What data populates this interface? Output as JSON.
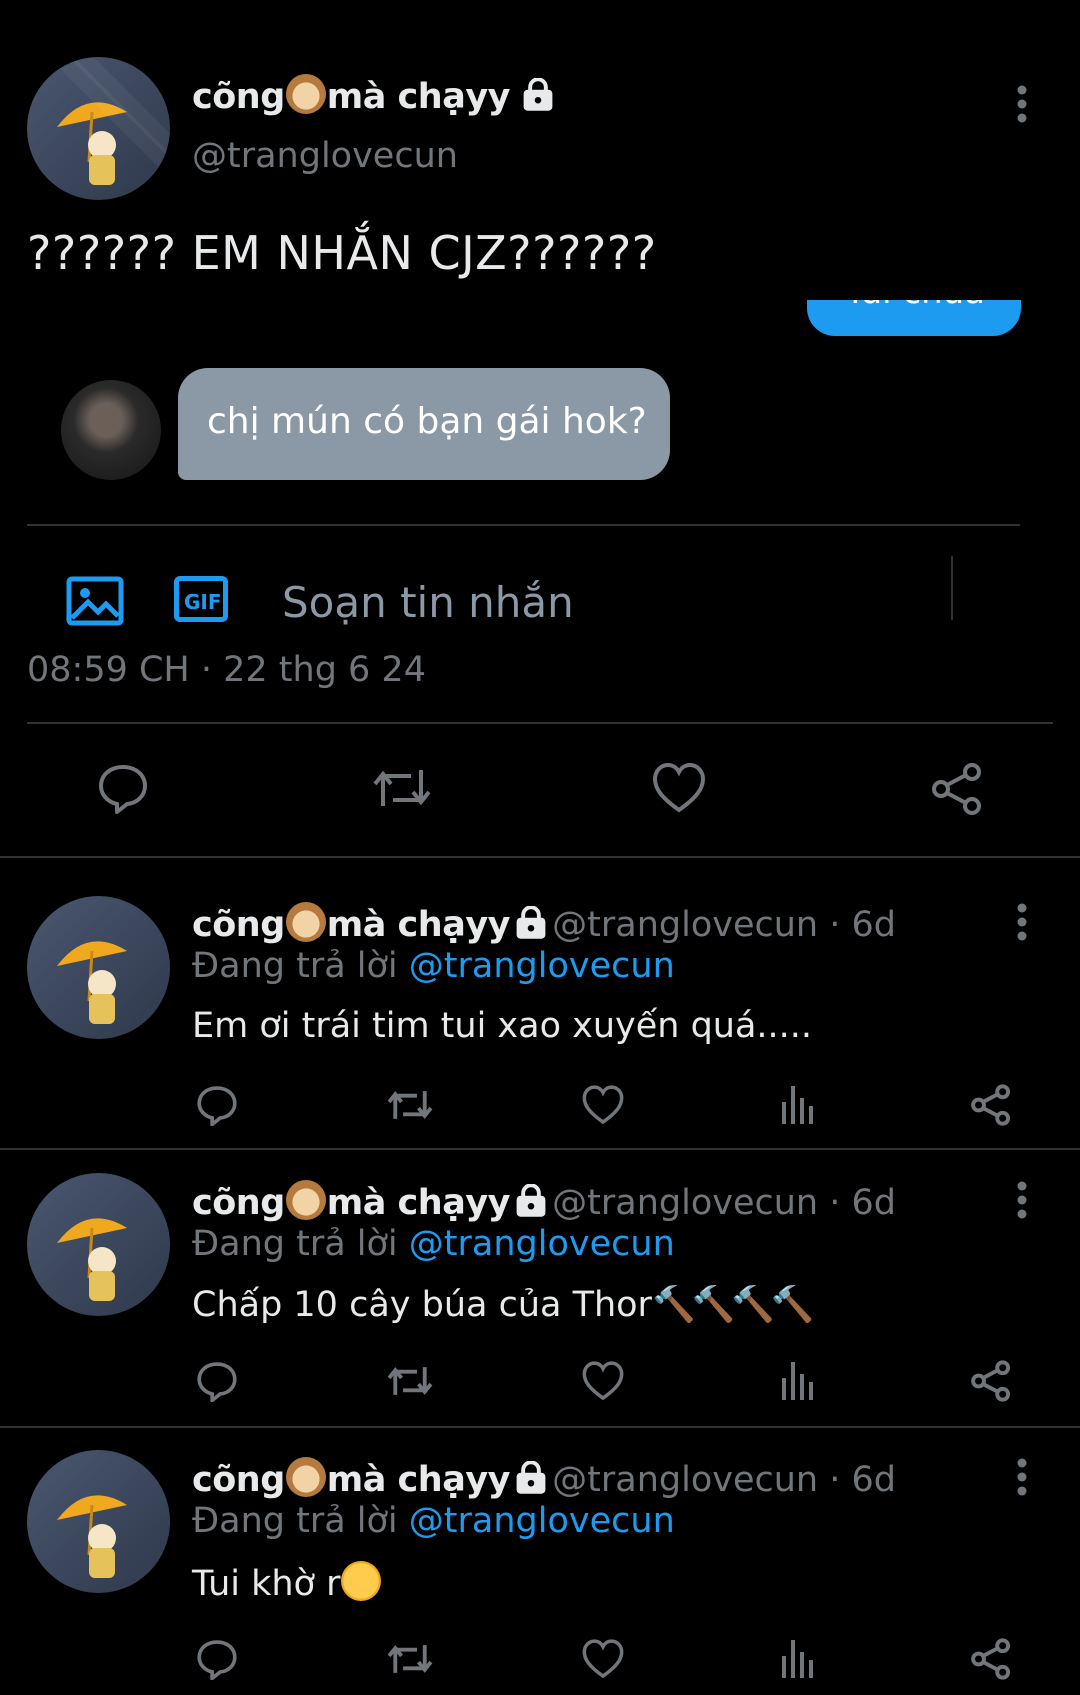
{
  "main_tweet": {
    "display_name": "cõng",
    "display_name_suffix": "mà chạyy",
    "handle": "@tranglovecun",
    "text": "?????? EM NHẮN CJZ??????",
    "timestamp": "08:59 CH · 22 thg 6 24",
    "embedded_chat": {
      "sent_message": "Tui chưa",
      "received_message": "chị mún có bạn gái hok?",
      "compose_placeholder": "Soạn tin nhắn",
      "gif_label": "GIF"
    }
  },
  "replies": [
    {
      "display_name": "cõng",
      "display_name_suffix": "mà chạyy",
      "handle_time": "@tranglovecun · 6d",
      "replying_prefix": "Đang trả lời",
      "replying_to": "@tranglovecun",
      "text": "Em ơi trái tim tui xao xuyến quá....."
    },
    {
      "display_name": "cõng",
      "display_name_suffix": "mà chạyy",
      "handle_time": "@tranglovecun · 6d",
      "replying_prefix": "Đang trả lời",
      "replying_to": "@tranglovecun",
      "text": "Chấp 10 cây búa của Thor",
      "emoji": "🔨🔨🔨🔨"
    },
    {
      "display_name": "cõng",
      "display_name_suffix": "mà chạyy",
      "handle_time": "@tranglovecun · 6d",
      "replying_prefix": "Đang trả lời",
      "replying_to": "@tranglovecun",
      "text": "Tui khờ r"
    }
  ],
  "colors": {
    "background": "#000000",
    "text": "#e7e9ea",
    "muted": "#71767b",
    "accent": "#1d9bf0",
    "bubble_received": "#8b98a5"
  },
  "icons": [
    "more-icon",
    "lock-icon",
    "reply-icon",
    "retweet-icon",
    "like-icon",
    "share-icon",
    "views-icon",
    "image-icon",
    "gif-icon"
  ]
}
